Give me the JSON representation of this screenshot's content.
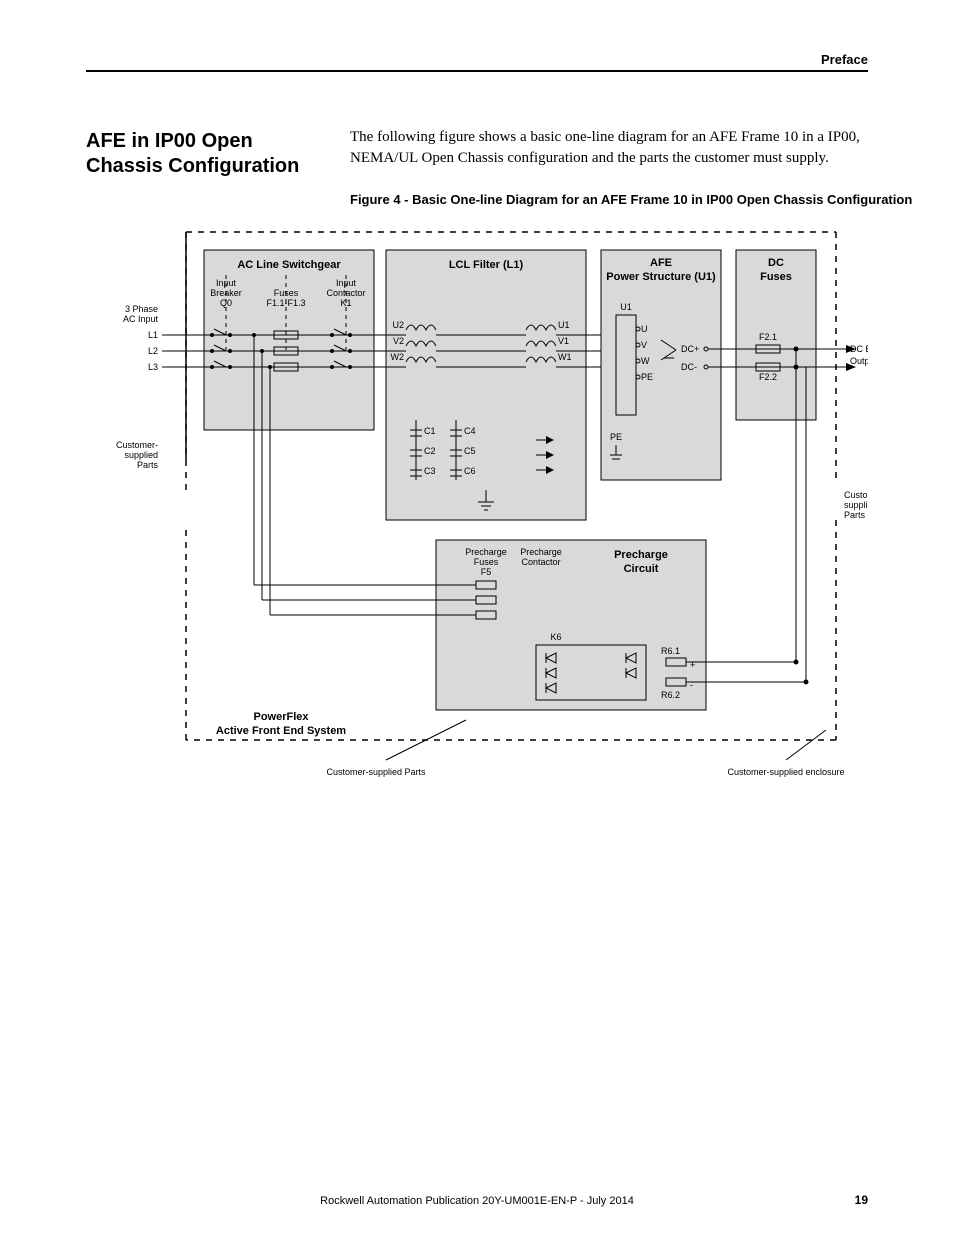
{
  "header": {
    "section": "Preface"
  },
  "page": {
    "number": "19",
    "publication": "Rockwell Automation Publication 20Y-UM001E-EN-P - July 2014"
  },
  "section_title": "AFE in IP00 Open Chassis Configuration",
  "intro": "The following figure shows a basic one-line diagram for an AFE Frame 10 in a IP00, NEMA/UL Open Chassis configuration and the parts the customer must supply.",
  "figure_caption": "Figure 4 - Basic One-line Diagram for an AFE Frame 10 in IP00 Open Chassis Configuration",
  "blocks": {
    "switchgear": "AC Line Switchgear",
    "lcl": "LCL Filter (L1)",
    "afe": "AFE",
    "afe2": "Power Structure (U1)",
    "dcfuses": "DC",
    "dcfuses2": "Fuses",
    "precharge": "Precharge",
    "precharge2": "Circuit",
    "pf": "PowerFlex",
    "pf2": "Active Front End System"
  },
  "labels": {
    "input_breaker": "Input",
    "input_breaker2": "Breaker",
    "q0": "Q0",
    "fuses": "Fuses",
    "f11": "F1.1-F1.3",
    "input_contactor": "Input",
    "input_contactor2": "Contactor",
    "k1": "K1",
    "phase": "3 Phase",
    "acinput": "AC Input",
    "l1": "L1",
    "l2": "L2",
    "l3": "L3",
    "cust": "Customer-",
    "cust2": "supplied",
    "cust3": "Parts",
    "u2": "U2",
    "v2": "V2",
    "w2": "W2",
    "u1": "U1",
    "v1": "V1",
    "w1": "W1",
    "c1": "C1",
    "c2": "C2",
    "c3": "C3",
    "c4": "C4",
    "c5": "C5",
    "c6": "C6",
    "u1t": "U1",
    "ut": "U",
    "vt": "V",
    "wt": "W",
    "pet": "PE",
    "pe": "PE",
    "dcp": "DC+",
    "dcm": "DC-",
    "f21": "F2.1",
    "f22": "F2.2",
    "dcbus": "DC Bus",
    "dcout": "Output",
    "pfuses": "Precharge",
    "pfuses2": "Fuses",
    "f5": "F5",
    "pcont": "Precharge",
    "pcont2": "Contactor",
    "k6": "K6",
    "r61": "R6.1",
    "r62": "R6.2",
    "plus": "+",
    "minus": "-",
    "csp": "Customer-supplied Parts",
    "cse": "Customer-supplied enclosure"
  }
}
